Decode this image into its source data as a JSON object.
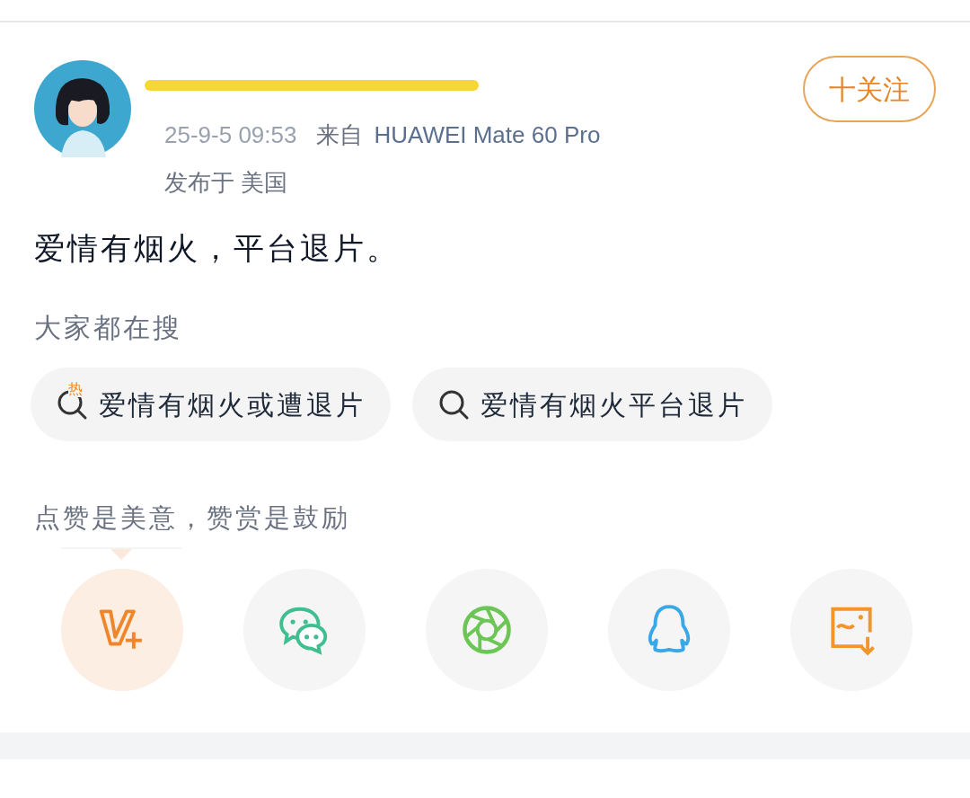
{
  "post": {
    "author_redacted": true,
    "follow_button": "十关注",
    "time": "25-9-5 09:53",
    "source_prefix": "来自",
    "source": "HUAWEI Mate 60 Pro",
    "location": "发布于 美国",
    "text": "爱情有烟火，平台退片。"
  },
  "searches": {
    "title": "大家都在搜",
    "items": [
      {
        "kind": "hot",
        "badge": "热",
        "label": "爱情有烟火或遭退片"
      },
      {
        "kind": "plain",
        "label": "爱情有烟火平台退片"
      }
    ]
  },
  "reward_hint": "点赞是美意，赞赏是鼓励",
  "share_buttons": [
    {
      "kind": "vplus",
      "selected": true
    },
    {
      "kind": "wechat",
      "selected": false
    },
    {
      "kind": "moments",
      "selected": false
    },
    {
      "kind": "qq",
      "selected": false
    },
    {
      "kind": "save-image",
      "selected": false
    }
  ]
}
